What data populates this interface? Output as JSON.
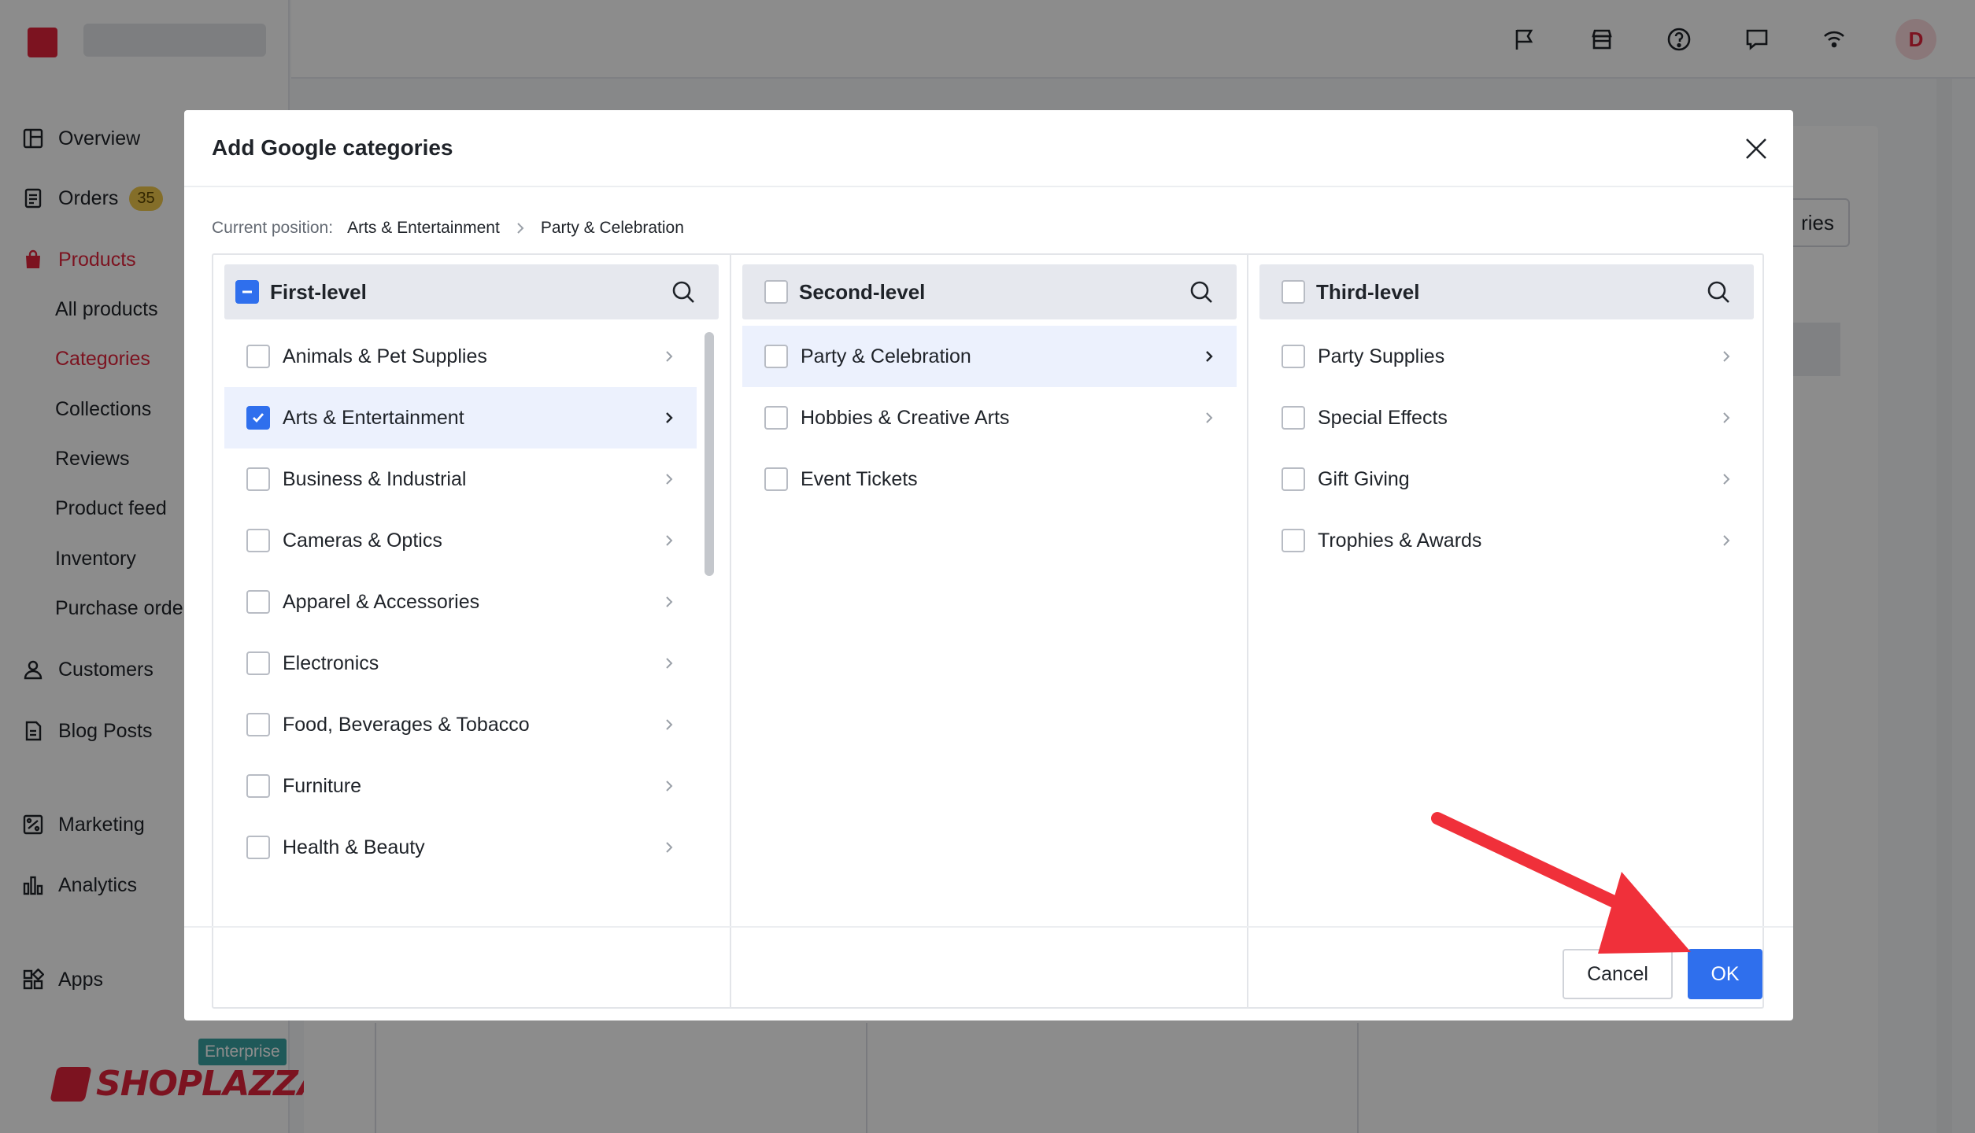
{
  "sidebar": {
    "items": [
      {
        "label": "Overview",
        "icon": "overview-icon"
      },
      {
        "label": "Orders",
        "icon": "orders-icon",
        "badge": "35"
      },
      {
        "label": "Products",
        "icon": "products-icon",
        "active": true
      },
      {
        "label": "All products"
      },
      {
        "label": "Categories",
        "active": true
      },
      {
        "label": "Collections"
      },
      {
        "label": "Reviews"
      },
      {
        "label": "Product feed"
      },
      {
        "label": "Inventory"
      },
      {
        "label": "Purchase orde"
      },
      {
        "label": "Customers",
        "icon": "customers-icon"
      },
      {
        "label": "Blog Posts",
        "icon": "blog-icon"
      },
      {
        "label": "Marketing",
        "icon": "marketing-icon"
      },
      {
        "label": "Analytics",
        "icon": "analytics-icon"
      },
      {
        "label": "Apps",
        "icon": "apps-icon"
      }
    ],
    "enterprise_badge": "Enterprise",
    "brand": "SHOPLAZZA"
  },
  "topbar": {
    "avatar_initial": "D",
    "icons": [
      "flag-icon",
      "store-icon",
      "help-icon",
      "chat-icon",
      "wifi-icon"
    ]
  },
  "background": {
    "button_fragment": "ries"
  },
  "modal": {
    "title": "Add Google categories",
    "breadcrumb": {
      "label": "Current position:",
      "path": [
        "Arts & Entertainment",
        "Party & Celebration"
      ]
    },
    "panels": [
      {
        "title": "First-level",
        "header_state": "indeterminate",
        "items": [
          {
            "label": "Animals & Pet Supplies",
            "checked": false,
            "selected": false
          },
          {
            "label": "Arts & Entertainment",
            "checked": true,
            "selected": true
          },
          {
            "label": "Business & Industrial",
            "checked": false,
            "selected": false
          },
          {
            "label": "Cameras & Optics",
            "checked": false,
            "selected": false
          },
          {
            "label": "Apparel & Accessories",
            "checked": false,
            "selected": false
          },
          {
            "label": "Electronics",
            "checked": false,
            "selected": false
          },
          {
            "label": "Food, Beverages & Tobacco",
            "checked": false,
            "selected": false
          },
          {
            "label": "Furniture",
            "checked": false,
            "selected": false
          },
          {
            "label": "Health & Beauty",
            "checked": false,
            "selected": false
          }
        ]
      },
      {
        "title": "Second-level",
        "header_state": "unchecked",
        "items": [
          {
            "label": "Party & Celebration",
            "checked": false,
            "selected": true,
            "arrow": true
          },
          {
            "label": "Hobbies & Creative Arts",
            "checked": false,
            "selected": false,
            "arrow": true
          },
          {
            "label": "Event Tickets",
            "checked": false,
            "selected": false,
            "arrow": false
          }
        ]
      },
      {
        "title": "Third-level",
        "header_state": "unchecked",
        "items": [
          {
            "label": "Party Supplies",
            "checked": false,
            "selected": false,
            "arrow": true
          },
          {
            "label": "Special Effects",
            "checked": false,
            "selected": false,
            "arrow": true
          },
          {
            "label": "Gift Giving",
            "checked": false,
            "selected": false,
            "arrow": true
          },
          {
            "label": "Trophies & Awards",
            "checked": false,
            "selected": false,
            "arrow": true
          }
        ]
      }
    ],
    "cancel_label": "Cancel",
    "ok_label": "OK"
  },
  "colors": {
    "accent": "#2f6fed",
    "brand_red": "#e2233b",
    "annotation_arrow": "#f0303a"
  }
}
